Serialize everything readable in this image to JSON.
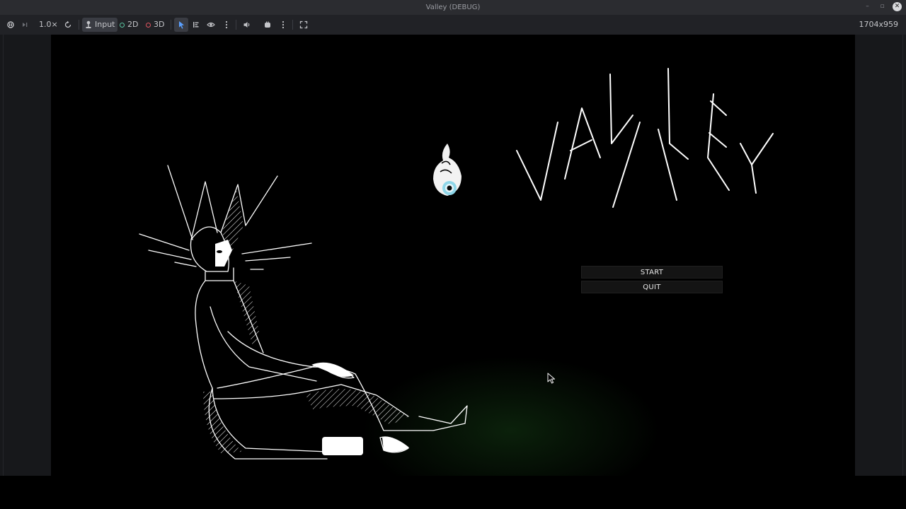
{
  "window": {
    "title": "Valley (DEBUG)",
    "controls": [
      "minimize",
      "maximize",
      "close"
    ]
  },
  "toolbar": {
    "speed": "1.0×",
    "input_label": "Input",
    "mode_2d": "2D",
    "mode_3d": "3D",
    "resolution": "1704x959",
    "colors": {
      "mode_2d": "#59c5a0",
      "mode_3d": "#e05560",
      "select_active": "#5aa0ff"
    }
  },
  "game": {
    "logo_text": "VALLEY",
    "menu": {
      "start_label": "START",
      "quit_label": "QUIT"
    }
  }
}
